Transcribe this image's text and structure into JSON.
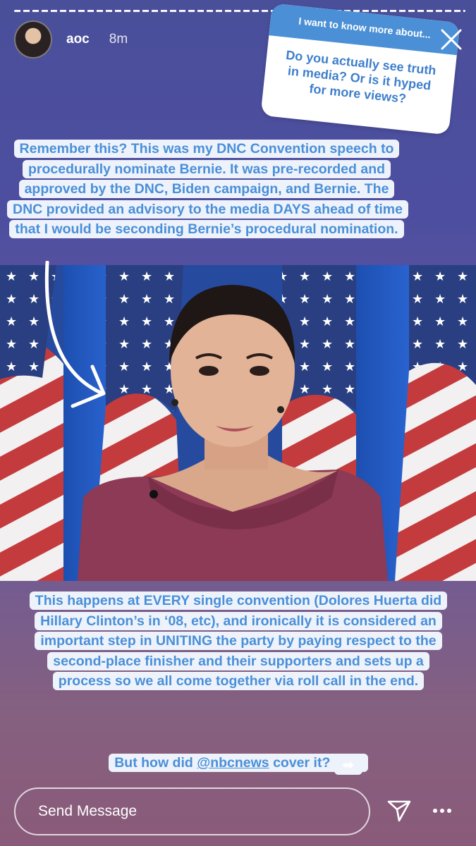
{
  "story": {
    "username": "aoc",
    "time_ago": "8m"
  },
  "question_sticker": {
    "header": "I want to know more about...",
    "question": "Do you actually see truth in media? Or is it hyped for more views?"
  },
  "captions": {
    "top": "Remember this? This was my DNC Convention speech to procedurally nominate Bernie. It was pre-recorded and approved by the DNC, Biden campaign, and Bernie. The DNC provided an advisory to the media DAYS ahead of time that I would be seconding Bernie’s procedural nomination.",
    "middle": "This happens at EVERY single convention (Dolores Huerta did Hillary Clinton’s in ‘08, etc), and ironically it is considered an important step in UNITING the party by paying respect to the second-place finisher and their supporters and sets up a process so we all come together via roll call in the end.",
    "bottom_prefix": "But how did ",
    "bottom_mention": "@nbcnews",
    "bottom_suffix": " cover it? ",
    "bottom_emoji": "➡"
  },
  "message_bar": {
    "placeholder": "Send Message"
  },
  "colors": {
    "caption_text": "#4a8fd9",
    "caption_bg": "#eef3fb",
    "sticker_header": "#4b90d6",
    "dress": "#8c3a55"
  },
  "icons": [
    "close-icon",
    "send-icon",
    "more-icon",
    "hand-drawn-arrow"
  ]
}
